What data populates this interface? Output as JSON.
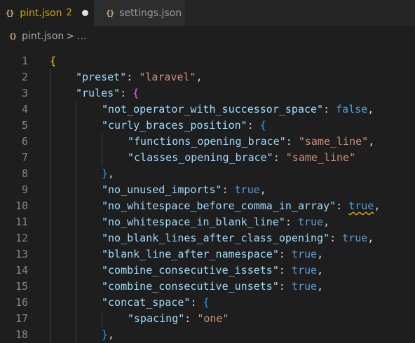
{
  "tabs": [
    {
      "label": "pint.json",
      "problems": "2",
      "icon": "json-braces-icon"
    },
    {
      "label": "settings.json",
      "icon": "json-braces-icon"
    }
  ],
  "breadcrumb": {
    "file": "pint.json",
    "separator": ">",
    "more": "..."
  },
  "editor": {
    "lines": [
      {
        "n": "1",
        "parts": [
          [
            "b1",
            "{"
          ]
        ]
      },
      {
        "n": "2",
        "parts": [
          [
            "key",
            "\"preset\""
          ],
          [
            "punc",
            ": "
          ],
          [
            "str",
            "\"laravel\""
          ],
          [
            "punc",
            ","
          ]
        ]
      },
      {
        "n": "3",
        "parts": [
          [
            "key",
            "\"rules\""
          ],
          [
            "punc",
            ": "
          ],
          [
            "b2",
            "{"
          ]
        ]
      },
      {
        "n": "4",
        "parts": [
          [
            "key",
            "\"not_operator_with_successor_space\""
          ],
          [
            "punc",
            ": "
          ],
          [
            "kw",
            "false"
          ],
          [
            "punc",
            ","
          ]
        ]
      },
      {
        "n": "5",
        "parts": [
          [
            "key",
            "\"curly_braces_position\""
          ],
          [
            "punc",
            ": "
          ],
          [
            "b3",
            "{"
          ]
        ]
      },
      {
        "n": "6",
        "parts": [
          [
            "key",
            "\"functions_opening_brace\""
          ],
          [
            "punc",
            ": "
          ],
          [
            "str",
            "\"same_line\""
          ],
          [
            "punc",
            ","
          ]
        ]
      },
      {
        "n": "7",
        "parts": [
          [
            "key",
            "\"classes_opening_brace\""
          ],
          [
            "punc",
            ": "
          ],
          [
            "str",
            "\"same_line\""
          ]
        ]
      },
      {
        "n": "8",
        "parts": [
          [
            "b3",
            "}"
          ],
          [
            "punc",
            ","
          ]
        ]
      },
      {
        "n": "9",
        "parts": [
          [
            "key",
            "\"no_unused_imports\""
          ],
          [
            "punc",
            ": "
          ],
          [
            "kw",
            "true"
          ],
          [
            "punc",
            ","
          ]
        ]
      },
      {
        "n": "10",
        "parts": [
          [
            "key",
            "\"no_whitespace_before_comma_in_array\""
          ],
          [
            "punc",
            ": "
          ],
          [
            "kw warn",
            "true"
          ],
          [
            "punc",
            ","
          ]
        ]
      },
      {
        "n": "11",
        "parts": [
          [
            "key",
            "\"no_whitespace_in_blank_line\""
          ],
          [
            "punc",
            ": "
          ],
          [
            "kw",
            "true"
          ],
          [
            "punc",
            ","
          ]
        ]
      },
      {
        "n": "12",
        "parts": [
          [
            "key",
            "\"no_blank_lines_after_class_opening\""
          ],
          [
            "punc",
            ": "
          ],
          [
            "kw",
            "true"
          ],
          [
            "punc",
            ","
          ]
        ]
      },
      {
        "n": "13",
        "parts": [
          [
            "key",
            "\"blank_line_after_namespace\""
          ],
          [
            "punc",
            ": "
          ],
          [
            "kw",
            "true"
          ],
          [
            "punc",
            ","
          ]
        ]
      },
      {
        "n": "14",
        "parts": [
          [
            "key",
            "\"combine_consecutive_issets\""
          ],
          [
            "punc",
            ": "
          ],
          [
            "kw",
            "true"
          ],
          [
            "punc",
            ","
          ]
        ]
      },
      {
        "n": "15",
        "parts": [
          [
            "key",
            "\"combine_consecutive_unsets\""
          ],
          [
            "punc",
            ": "
          ],
          [
            "kw",
            "true"
          ],
          [
            "punc",
            ","
          ]
        ]
      },
      {
        "n": "16",
        "parts": [
          [
            "key",
            "\"concat_space\""
          ],
          [
            "punc",
            ": "
          ],
          [
            "b3",
            "{"
          ]
        ]
      },
      {
        "n": "17",
        "parts": [
          [
            "key",
            "\"spacing\""
          ],
          [
            "punc",
            ": "
          ],
          [
            "str",
            "\"one\""
          ]
        ]
      },
      {
        "n": "18",
        "parts": [
          [
            "b3",
            "}"
          ],
          [
            "punc",
            ","
          ]
        ]
      }
    ]
  },
  "colors": {
    "background": "#1e1e1e",
    "key": "#9cdcfe",
    "string": "#ce9178",
    "keyword": "#569cd6",
    "warning": "#cca700"
  }
}
